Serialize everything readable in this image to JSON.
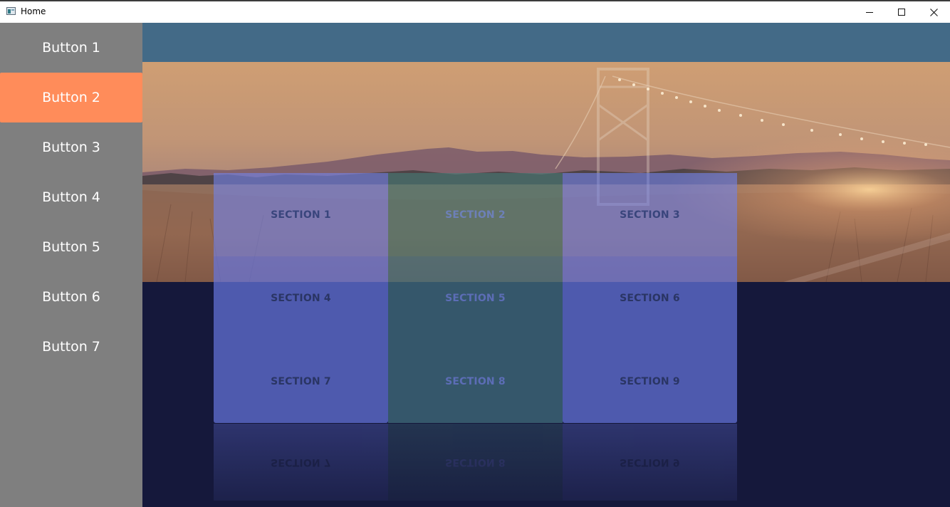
{
  "window": {
    "title": "Home",
    "controls": [
      "minimize-icon",
      "maximize-icon",
      "close-icon"
    ]
  },
  "sidebar": {
    "items": [
      {
        "label": "Button 1"
      },
      {
        "label": "Button 2",
        "active": true
      },
      {
        "label": "Button 3"
      },
      {
        "label": "Button 4"
      },
      {
        "label": "Button 5"
      },
      {
        "label": "Button 6"
      },
      {
        "label": "Button 7"
      }
    ]
  },
  "main": {
    "sections": [
      {
        "label": "SECTION 1"
      },
      {
        "label": "SECTION 2"
      },
      {
        "label": "SECTION 3"
      },
      {
        "label": "SECTION 4"
      },
      {
        "label": "SECTION 5"
      },
      {
        "label": "SECTION 6"
      },
      {
        "label": "SECTION 7"
      },
      {
        "label": "SECTION 8"
      },
      {
        "label": "SECTION 9"
      }
    ]
  },
  "colors": {
    "sidebar_bg": "#7f7f7f",
    "active_button": "#ff8c5a",
    "top_band": "#436a87",
    "main_bg": "#15183b",
    "section_blue": "#6776e0",
    "section_teal": "#42707e"
  }
}
